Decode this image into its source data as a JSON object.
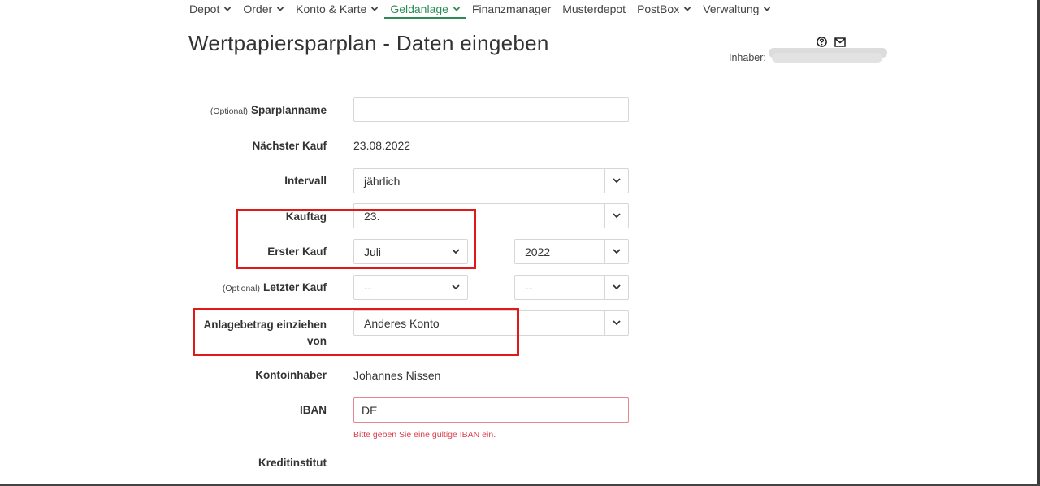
{
  "nav": {
    "items": [
      {
        "label": "Depot",
        "dropdown": true
      },
      {
        "label": "Order",
        "dropdown": true
      },
      {
        "label": "Konto & Karte",
        "dropdown": true
      },
      {
        "label": "Geldanlage",
        "dropdown": true,
        "active": true
      },
      {
        "label": "Finanzmanager",
        "dropdown": false
      },
      {
        "label": "Musterdepot",
        "dropdown": false
      },
      {
        "label": "PostBox",
        "dropdown": true
      },
      {
        "label": "Verwaltung",
        "dropdown": true
      }
    ]
  },
  "header": {
    "title": "Wertpapiersparplan - Daten eingeben",
    "owner_label": "Inhaber:",
    "icons": [
      "help-icon",
      "mail-icon"
    ]
  },
  "form": {
    "optional_tag": "(Optional)",
    "sparplanname": {
      "label": "Sparplanname",
      "value": ""
    },
    "naechster_kauf": {
      "label": "Nächster Kauf",
      "value": "23.08.2022"
    },
    "intervall": {
      "label": "Intervall",
      "value": "jährlich"
    },
    "kauftag": {
      "label": "Kauftag",
      "value": "23."
    },
    "erster_kauf": {
      "label": "Erster Kauf",
      "month": "Juli",
      "year": "2022"
    },
    "letzter_kauf": {
      "label": "Letzter Kauf",
      "month": "--",
      "year": "--"
    },
    "anlagebetrag": {
      "label_line1": "Anlagebetrag einziehen",
      "label_line2": "von",
      "value": "Anderes Konto"
    },
    "kontoinhaber": {
      "label": "Kontoinhaber",
      "value": "Johannes Nissen"
    },
    "iban": {
      "label": "IBAN",
      "value": "DE",
      "error": "Bitte geben Sie eine gültige IBAN ein."
    },
    "kreditinstitut": {
      "label": "Kreditinstitut",
      "value": ""
    }
  },
  "colors": {
    "accent": "#2e8b57",
    "highlight": "#e0191b",
    "error": "#d9414b"
  }
}
